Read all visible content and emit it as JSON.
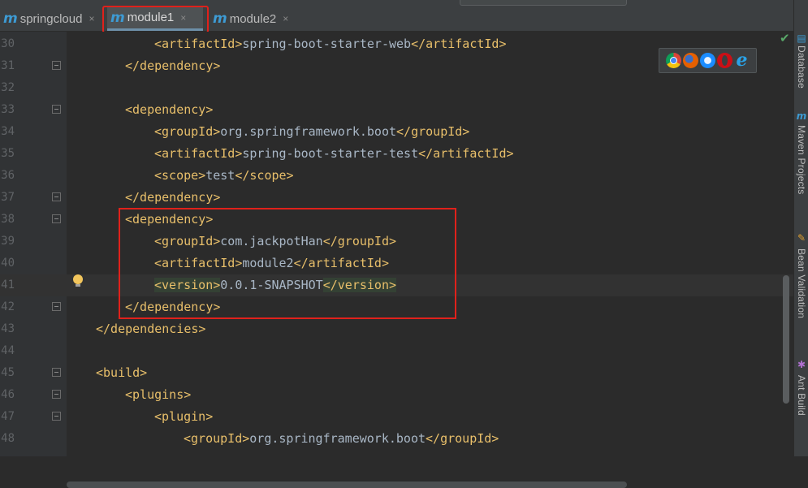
{
  "tabs": [
    {
      "icon": "maven-m-icon",
      "label": "springcloud",
      "active": false
    },
    {
      "icon": "maven-m-icon",
      "label": "module1",
      "active": true
    },
    {
      "icon": "maven-m-icon",
      "label": "module2",
      "active": false
    }
  ],
  "tab_close_glyph": "×",
  "maven_glyph": "m",
  "editor": {
    "current_line": 41,
    "lines": [
      {
        "n": "30",
        "indent": 2,
        "fold": false,
        "parts": [
          {
            "t": "tag",
            "s": "<artifactId>"
          },
          {
            "t": "txt",
            "s": "spring-boot-starter-web"
          },
          {
            "t": "tag",
            "s": "</artifactId>"
          }
        ]
      },
      {
        "n": "31",
        "indent": 1,
        "fold": true,
        "parts": [
          {
            "t": "tag",
            "s": "</dependency>"
          }
        ]
      },
      {
        "n": "32",
        "indent": 0,
        "fold": false,
        "parts": []
      },
      {
        "n": "33",
        "indent": 1,
        "fold": true,
        "parts": [
          {
            "t": "tag",
            "s": "<dependency>"
          }
        ]
      },
      {
        "n": "34",
        "indent": 2,
        "fold": false,
        "parts": [
          {
            "t": "tag",
            "s": "<groupId>"
          },
          {
            "t": "txt",
            "s": "org.springframework.boot"
          },
          {
            "t": "tag",
            "s": "</groupId>"
          }
        ]
      },
      {
        "n": "35",
        "indent": 2,
        "fold": false,
        "parts": [
          {
            "t": "tag",
            "s": "<artifactId>"
          },
          {
            "t": "txt",
            "s": "spring-boot-starter-test"
          },
          {
            "t": "tag",
            "s": "</artifactId>"
          }
        ]
      },
      {
        "n": "36",
        "indent": 2,
        "fold": false,
        "parts": [
          {
            "t": "tag",
            "s": "<scope>"
          },
          {
            "t": "txt",
            "s": "test"
          },
          {
            "t": "tag",
            "s": "</scope>"
          }
        ]
      },
      {
        "n": "37",
        "indent": 1,
        "fold": true,
        "parts": [
          {
            "t": "tag",
            "s": "</dependency>"
          }
        ]
      },
      {
        "n": "38",
        "indent": 1,
        "fold": true,
        "parts": [
          {
            "t": "tag",
            "s": "<dependency>"
          }
        ]
      },
      {
        "n": "39",
        "indent": 2,
        "fold": false,
        "parts": [
          {
            "t": "tag",
            "s": "<groupId>"
          },
          {
            "t": "txt",
            "s": "com.jackpotHan"
          },
          {
            "t": "tag",
            "s": "</groupId>"
          }
        ]
      },
      {
        "n": "40",
        "indent": 2,
        "fold": false,
        "parts": [
          {
            "t": "tag",
            "s": "<artifactId>"
          },
          {
            "t": "txt",
            "s": "module2"
          },
          {
            "t": "tag",
            "s": "</artifactId>"
          }
        ]
      },
      {
        "n": "41",
        "indent": 2,
        "fold": false,
        "parts": [
          {
            "t": "tag hl",
            "s": "<version>"
          },
          {
            "t": "txt",
            "s": "0.0.1-SNAPSHOT"
          },
          {
            "t": "tag hl",
            "s": "</version>"
          }
        ]
      },
      {
        "n": "42",
        "indent": 1,
        "fold": true,
        "parts": [
          {
            "t": "tag",
            "s": "</dependency>"
          }
        ]
      },
      {
        "n": "43",
        "indent": 0,
        "fold": false,
        "parts": [
          {
            "t": "tag",
            "s": "</dependencies>"
          }
        ]
      },
      {
        "n": "44",
        "indent": 0,
        "fold": false,
        "parts": []
      },
      {
        "n": "45",
        "indent": 0,
        "fold": true,
        "parts": [
          {
            "t": "tag",
            "s": "<build>"
          }
        ]
      },
      {
        "n": "46",
        "indent": 1,
        "fold": true,
        "parts": [
          {
            "t": "tag",
            "s": "<plugins>"
          }
        ]
      },
      {
        "n": "47",
        "indent": 2,
        "fold": true,
        "parts": [
          {
            "t": "tag",
            "s": "<plugin>"
          }
        ]
      },
      {
        "n": "48",
        "indent": 3,
        "fold": false,
        "parts": [
          {
            "t": "tag",
            "s": "<groupId>"
          },
          {
            "t": "txt",
            "s": "org.springframework.boot"
          },
          {
            "t": "tag",
            "s": "</groupId>"
          }
        ]
      }
    ]
  },
  "browser_icons": [
    "chrome-icon",
    "firefox-icon",
    "safari-icon",
    "opera-icon",
    "ie-icon"
  ],
  "ie_glyph": "e",
  "check_glyph": "✔",
  "side_panel": [
    {
      "icon": "database-icon",
      "glyph": "▤",
      "label": "Database"
    },
    {
      "icon": "maven-projects-icon",
      "glyph": "m",
      "label": "Maven Projects"
    },
    {
      "icon": "bean-validation-icon",
      "glyph": "✎",
      "label": "Bean Validation"
    },
    {
      "icon": "ant-build-icon",
      "glyph": "✱",
      "label": "Ant Build"
    }
  ],
  "colors": {
    "tag": "#e8bf6a",
    "text": "#a9b7c6",
    "highlight_box": "#e0211b"
  }
}
